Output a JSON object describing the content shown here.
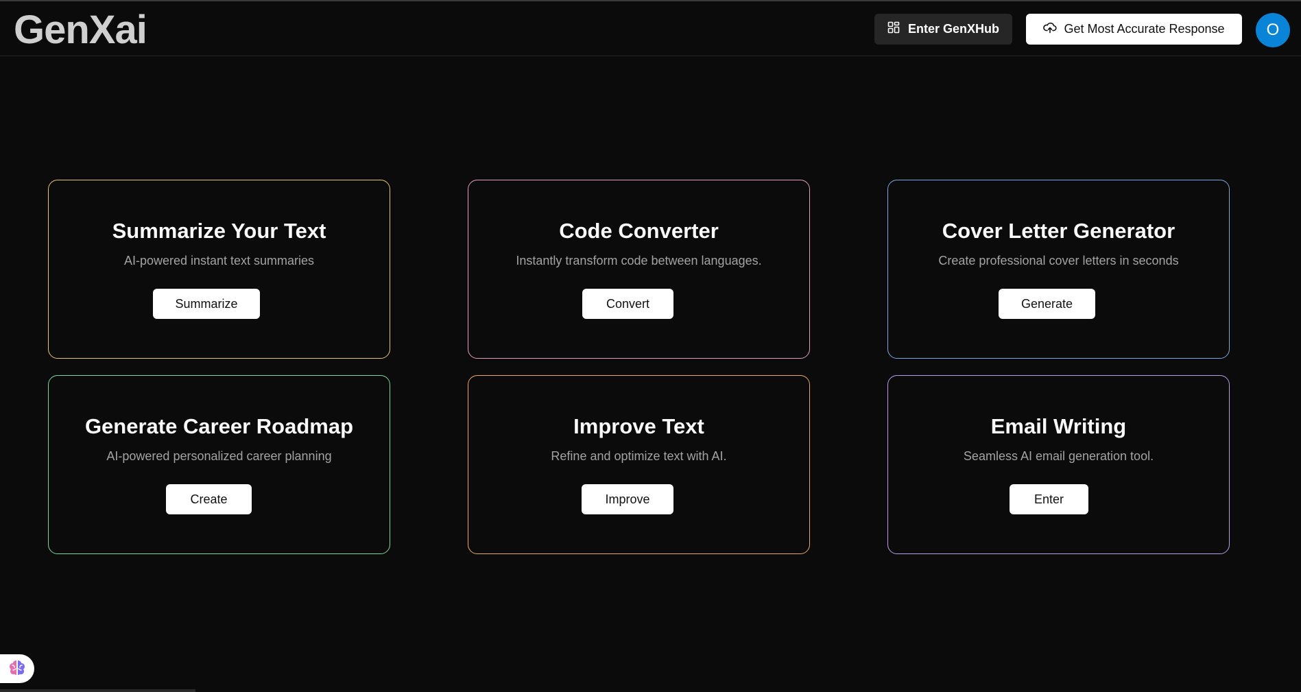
{
  "header": {
    "logo": "GenXai",
    "hub_button": "Enter GenXHub",
    "accurate_button": "Get Most Accurate Response",
    "avatar_initial": "O"
  },
  "cards": [
    {
      "title": "Summarize Your Text",
      "desc": "AI-powered instant text summaries",
      "action": "Summarize",
      "border_color": "#e6c76a"
    },
    {
      "title": "Code Converter",
      "desc": "Instantly transform code between languages.",
      "action": "Convert",
      "border_color": "#e59fc0"
    },
    {
      "title": "Cover Letter Generator",
      "desc": "Create professional cover letters in seconds",
      "action": "Generate",
      "border_color": "#7fa7e0"
    },
    {
      "title": "Generate Career Roadmap",
      "desc": "AI-powered personalized career planning",
      "action": "Create",
      "border_color": "#7fd6a0"
    },
    {
      "title": "Improve Text",
      "desc": "Refine and optimize text with AI.",
      "action": "Improve",
      "border_color": "#e8a966"
    },
    {
      "title": "Email Writing",
      "desc": "Seamless AI email generation tool.",
      "action": "Enter",
      "border_color": "#b7a0ea"
    }
  ],
  "icons": {
    "hub": "grid-icon",
    "accurate": "cloud-upload-icon",
    "assistant": "brain-icon"
  },
  "colors": {
    "background": "#0b0b0b",
    "avatar": "#0a84d6"
  }
}
